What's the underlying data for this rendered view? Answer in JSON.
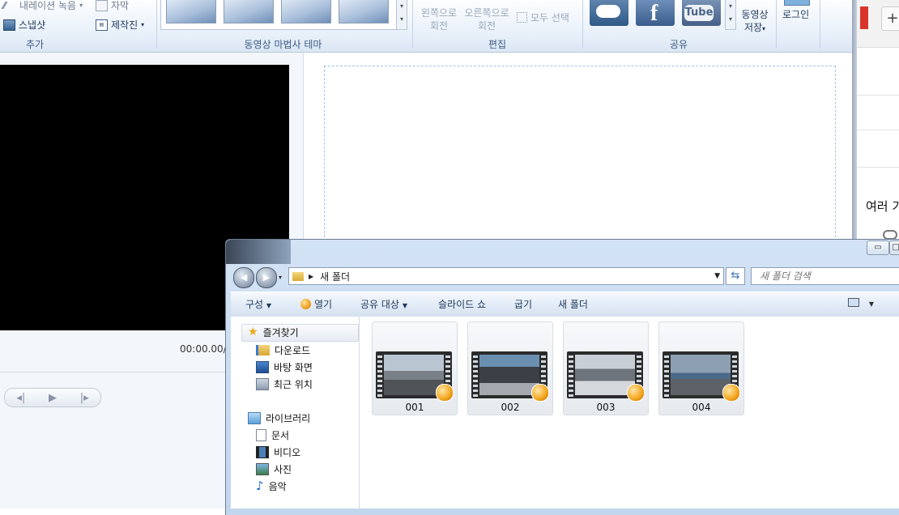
{
  "ribbon": {
    "add_group": {
      "label": "추가",
      "narration": "내레이션 녹음",
      "snapshot": "스냅샷",
      "caption": "자막",
      "credits": "제작진"
    },
    "theme_group": {
      "label": "동영상 마법사 테마"
    },
    "edit_group": {
      "label": "편집",
      "rotate_left": [
        "왼쪽으로",
        "회전"
      ],
      "rotate_right": [
        "오른쪽으로",
        "회전"
      ],
      "select_all": "모두 선택"
    },
    "share_group": {
      "label": "공유",
      "save_movie": [
        "동영상",
        "저장"
      ]
    },
    "login": "로그인"
  },
  "player": {
    "timecode": "00:00.00/"
  },
  "bg_window": {
    "text": "여러 기"
  },
  "explorer": {
    "address": "새 폴더",
    "search_placeholder": "새 폴더 검색",
    "toolbar": {
      "organize": "구성",
      "open": "열기",
      "share_with": "공유 대상",
      "slideshow": "슬라이드 쇼",
      "burn": "굽기",
      "new_folder": "새 폴더"
    },
    "nav": {
      "favorites": "즐겨찾기",
      "favorites_items": [
        "다운로드",
        "바탕 화면",
        "최근 위치"
      ],
      "libraries": "라이브러리",
      "library_items": [
        "문서",
        "비디오",
        "사진",
        "음악"
      ]
    },
    "files": [
      "001",
      "002",
      "003",
      "004"
    ]
  },
  "colors": {
    "accent": "#1e395b",
    "preview_bg": "#000000",
    "badge": "#f3a51c"
  }
}
